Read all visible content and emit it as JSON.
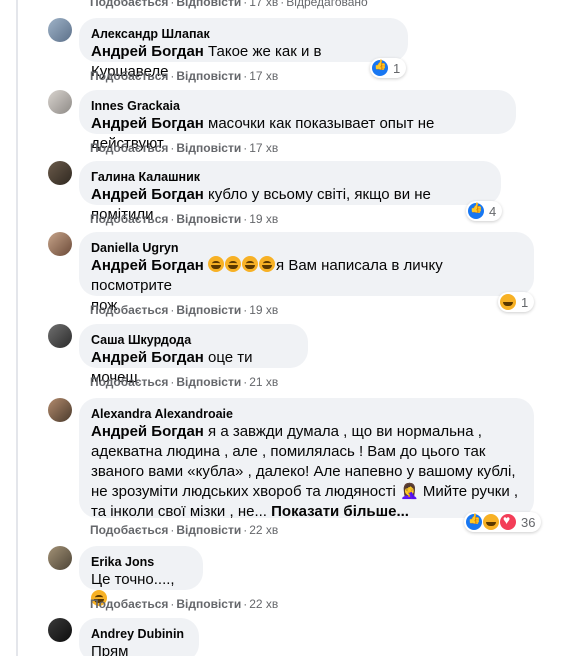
{
  "top_actions": {
    "like": "Подобається",
    "reply": "Відповісти",
    "time": "17 хв",
    "edited": "Відредаговано"
  },
  "comments": [
    {
      "author": "Александр Шлапак",
      "mention": "Андрей Богдан",
      "text": " Такое же как и в Куршавеле",
      "like": "Подобається",
      "reply": "Відповісти",
      "time": "17 хв",
      "reaction_count": "1"
    },
    {
      "author": "Innes Grackaia",
      "mention": "Андрей Богдан",
      "text": " масочки как показывает опыт не действуют",
      "like": "Подобається",
      "reply": "Відповісти",
      "time": "17 хв"
    },
    {
      "author": "Галина Калашник",
      "mention": "Андрей Богдан",
      "text": " кубло у всьому світі, якщо ви не помітили",
      "like": "Подобається",
      "reply": "Відповісти",
      "time": "19 хв",
      "reaction_count": "4"
    },
    {
      "author": "Daniella Ugryn",
      "mention": "Андрей Богдан",
      "text_line1": "я Вам написала в личку посмотрите",
      "text_line2": "пож",
      "like": "Подобається",
      "reply": "Відповісти",
      "time": "19 хв",
      "reaction_count": "1"
    },
    {
      "author": "Саша Шкурдода",
      "mention": "Андрей Богдан",
      "text": " оце ти мочеш",
      "like": "Подобається",
      "reply": "Відповісти",
      "time": "21 хв"
    },
    {
      "author": "Alexandra Alexandroaie",
      "mention": "Андрей Богдан",
      "line1": " я а завжди думала , що ви нормальна ,",
      "line2": "адекватна людина , але , помилялась ! Вам до цього так",
      "line3": "званого вами «кубла» , далеко! Але напевно у вашому кублі,",
      "line4": "не зрозуміти людських хвороб та людяності 🤦‍♀️ Мийте ручки ,",
      "line5": "та інколи свої мізки , не...",
      "more": "Показати більше...",
      "like": "Подобається",
      "reply": "Відповісти",
      "time": "22 хв",
      "reaction_count": "36"
    },
    {
      "author": "Erika Jons",
      "text": "Це точно...., ",
      "like": "Подобається",
      "reply": "Відповісти",
      "time": "22 хв"
    },
    {
      "author": "Andrey Dubinin",
      "text": "Прям стихами"
    }
  ],
  "icons": {
    "like": "like-icon",
    "haha": "haha-icon",
    "love": "love-icon"
  },
  "colors": {
    "bubble": "#f0f2f5",
    "meta": "#65676b",
    "like_blue": "#1877f2",
    "haha_yellow": "#f7b125",
    "love_red": "#f33e58"
  }
}
